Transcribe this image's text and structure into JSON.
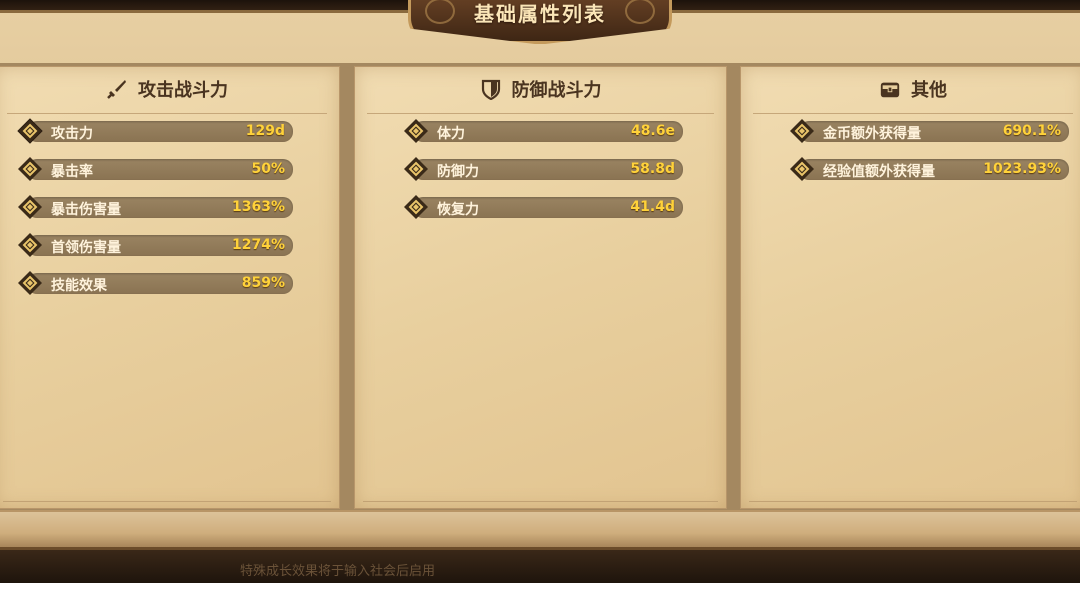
{
  "title": "基础属性列表",
  "panels": {
    "attack": {
      "label": "攻击战斗力",
      "icon": "sword-icon",
      "rows": [
        {
          "name": "攻击力",
          "value": "129d"
        },
        {
          "name": "暴击率",
          "value": "50%"
        },
        {
          "name": "暴击伤害量",
          "value": "1363%"
        },
        {
          "name": "首领伤害量",
          "value": "1274%"
        },
        {
          "name": "技能效果",
          "value": "859%"
        }
      ]
    },
    "defense": {
      "label": "防御战斗力",
      "icon": "shield-icon",
      "rows": [
        {
          "name": "体力",
          "value": "48.6e"
        },
        {
          "name": "防御力",
          "value": "58.8d"
        },
        {
          "name": "恢复力",
          "value": "41.4d"
        }
      ]
    },
    "other": {
      "label": "其他",
      "icon": "chest-icon",
      "rows": [
        {
          "name": "金币额外获得量",
          "value": "690.1%"
        },
        {
          "name": "经验值额外获得量",
          "value": "1023.93%"
        }
      ]
    }
  },
  "footer_hint": "特殊成长效果将于输入社会后启用",
  "colors": {
    "value_text": "#ffd23a",
    "bar": "#8f7957",
    "parchment": "#e8cf9e",
    "banner": "#4a2e19"
  }
}
